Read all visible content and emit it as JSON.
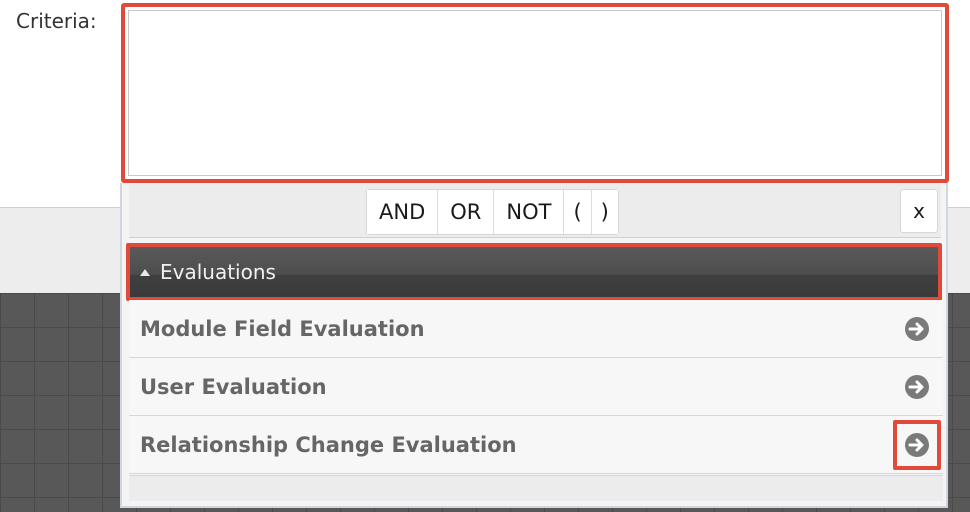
{
  "criteria": {
    "label": "Criteria:",
    "value": ""
  },
  "operators": {
    "buttons": [
      "AND",
      "OR",
      "NOT",
      "(",
      ")"
    ],
    "close_label": "x"
  },
  "evaluations": {
    "title": "Evaluations",
    "items": [
      {
        "label": "Module Field Evaluation",
        "icon": "arrow-right-circle-icon"
      },
      {
        "label": "User Evaluation",
        "icon": "arrow-right-circle-icon"
      },
      {
        "label": "Relationship Change Evaluation",
        "icon": "arrow-right-circle-icon"
      }
    ]
  },
  "colors": {
    "highlight": "#e04a3a",
    "header_bg": "#4a4a4a",
    "row_text": "#666666"
  }
}
